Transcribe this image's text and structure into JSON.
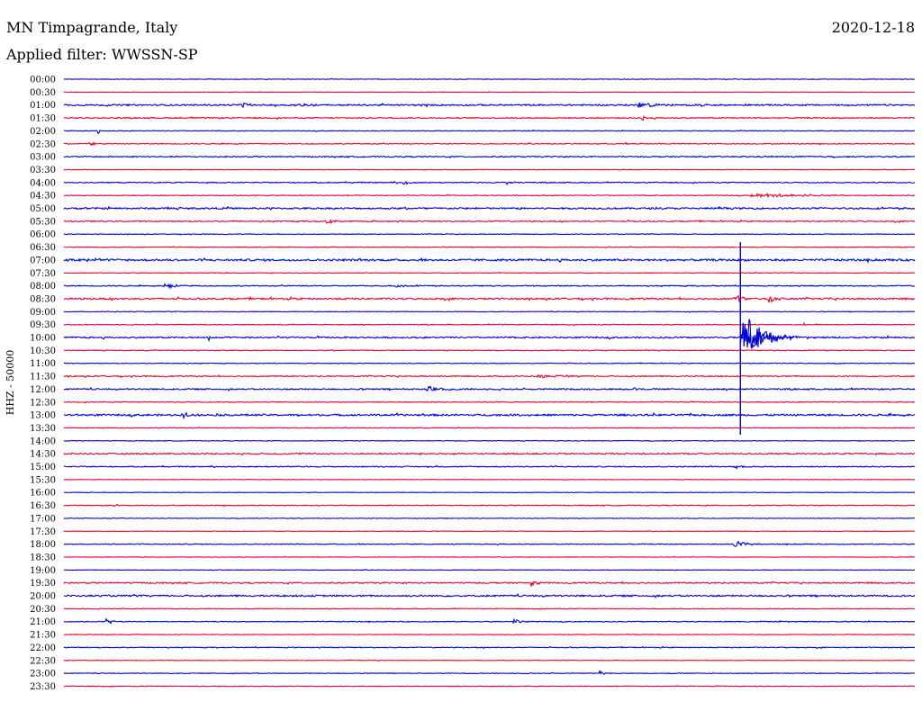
{
  "header": {
    "station": "MN Timpagrande, Italy",
    "date": "2020-12-18",
    "filter": "Applied filter: WWSSN-SP"
  },
  "chart_data": {
    "type": "line",
    "title": "MN Timpagrande, Italy",
    "subtitle": "Applied filter: WWSSN-SP",
    "ylabel": "HHZ - 50000",
    "colors": {
      "even_row": "#0000cc",
      "odd_row": "#e8002a"
    },
    "rows": [
      {
        "label": "00:00",
        "amp": 0.3,
        "events": []
      },
      {
        "label": "00:30",
        "amp": 0.2,
        "events": []
      },
      {
        "label": "01:00",
        "amp": 0.9,
        "events": [
          {
            "pos": 0.21,
            "width": 0.02,
            "amp": 3
          },
          {
            "pos": 0.27,
            "width": 0.04,
            "amp": 2
          },
          {
            "pos": 0.68,
            "width": 0.08,
            "amp": 1.6
          }
        ]
      },
      {
        "label": "01:30",
        "amp": 0.7,
        "events": [
          {
            "pos": 0.68,
            "width": 0.01,
            "amp": 2.5
          }
        ]
      },
      {
        "label": "02:00",
        "amp": 0.4,
        "events": [
          {
            "pos": 0.04,
            "width": 0.005,
            "amp": 3
          }
        ]
      },
      {
        "label": "02:30",
        "amp": 0.5,
        "events": [
          {
            "pos": 0.03,
            "width": 0.02,
            "amp": 2
          },
          {
            "pos": 0.66,
            "width": 0.004,
            "amp": 2
          }
        ]
      },
      {
        "label": "03:00",
        "amp": 0.7,
        "events": []
      },
      {
        "label": "03:30",
        "amp": 0.3,
        "events": []
      },
      {
        "label": "04:00",
        "amp": 0.6,
        "events": [
          {
            "pos": 0.4,
            "width": 0.02,
            "amp": 2
          },
          {
            "pos": 0.52,
            "width": 0.02,
            "amp": 2
          }
        ]
      },
      {
        "label": "04:30",
        "amp": 0.5,
        "events": [
          {
            "pos": 0.82,
            "width": 0.18,
            "amp": 1.5
          }
        ]
      },
      {
        "label": "05:00",
        "amp": 1.0,
        "events": []
      },
      {
        "label": "05:30",
        "amp": 0.7,
        "events": [
          {
            "pos": 0.31,
            "width": 0.02,
            "amp": 3
          },
          {
            "pos": 0.36,
            "width": 0.01,
            "amp": 2
          }
        ]
      },
      {
        "label": "06:00",
        "amp": 0.4,
        "events": []
      },
      {
        "label": "06:30",
        "amp": 0.4,
        "events": []
      },
      {
        "label": "07:00",
        "amp": 1.2,
        "events": [
          {
            "pos": 0.02,
            "width": 0.04,
            "amp": 1.6
          }
        ]
      },
      {
        "label": "07:30",
        "amp": 0.4,
        "events": []
      },
      {
        "label": "08:00",
        "amp": 0.6,
        "events": [
          {
            "pos": 0.12,
            "width": 0.04,
            "amp": 2.4
          },
          {
            "pos": 0.39,
            "width": 0.03,
            "amp": 1.8
          }
        ]
      },
      {
        "label": "08:30",
        "amp": 1.0,
        "events": [
          {
            "pos": 0.79,
            "width": 0.02,
            "amp": 4
          },
          {
            "pos": 0.83,
            "width": 0.03,
            "amp": 3
          }
        ]
      },
      {
        "label": "09:00",
        "amp": 0.4,
        "events": []
      },
      {
        "label": "09:30",
        "amp": 0.5,
        "events": [
          {
            "pos": 0.87,
            "width": 0.003,
            "amp": 2.5
          }
        ]
      },
      {
        "label": "10:00",
        "amp": 0.9,
        "events": [
          {
            "pos": 0.17,
            "width": 0.02,
            "amp": 3
          },
          {
            "pos": 0.805,
            "width": 0.06,
            "amp": 18
          }
        ]
      },
      {
        "label": "10:30",
        "amp": 0.5,
        "events": []
      },
      {
        "label": "11:00",
        "amp": 0.4,
        "events": []
      },
      {
        "label": "11:30",
        "amp": 0.7,
        "events": [
          {
            "pos": 0.56,
            "width": 0.05,
            "amp": 1.7
          }
        ]
      },
      {
        "label": "12:00",
        "amp": 0.8,
        "events": [
          {
            "pos": 0.43,
            "width": 0.05,
            "amp": 2.3
          },
          {
            "pos": 0.67,
            "width": 0.01,
            "amp": 2
          }
        ]
      },
      {
        "label": "12:30",
        "amp": 0.5,
        "events": []
      },
      {
        "label": "13:00",
        "amp": 1.1,
        "events": [
          {
            "pos": 0.14,
            "width": 0.02,
            "amp": 2.5
          }
        ]
      },
      {
        "label": "13:30",
        "amp": 0.4,
        "events": []
      },
      {
        "label": "14:00",
        "amp": 0.4,
        "events": []
      },
      {
        "label": "14:30",
        "amp": 0.8,
        "events": []
      },
      {
        "label": "15:00",
        "amp": 0.6,
        "events": [
          {
            "pos": 0.79,
            "width": 0.02,
            "amp": 1.8
          }
        ]
      },
      {
        "label": "15:30",
        "amp": 0.3,
        "events": []
      },
      {
        "label": "16:00",
        "amp": 0.3,
        "events": []
      },
      {
        "label": "16:30",
        "amp": 0.5,
        "events": [
          {
            "pos": 0.06,
            "width": 0.01,
            "amp": 2
          }
        ]
      },
      {
        "label": "17:00",
        "amp": 0.3,
        "events": []
      },
      {
        "label": "17:30",
        "amp": 0.3,
        "events": []
      },
      {
        "label": "18:00",
        "amp": 0.5,
        "events": [
          {
            "pos": 0.79,
            "width": 0.04,
            "amp": 3
          }
        ]
      },
      {
        "label": "18:30",
        "amp": 0.3,
        "events": []
      },
      {
        "label": "19:00",
        "amp": 0.3,
        "events": []
      },
      {
        "label": "19:30",
        "amp": 0.8,
        "events": [
          {
            "pos": 0.55,
            "width": 0.02,
            "amp": 2
          }
        ]
      },
      {
        "label": "20:00",
        "amp": 1.0,
        "events": []
      },
      {
        "label": "20:30",
        "amp": 0.4,
        "events": []
      },
      {
        "label": "21:00",
        "amp": 0.5,
        "events": [
          {
            "pos": 0.05,
            "width": 0.02,
            "amp": 3
          },
          {
            "pos": 0.53,
            "width": 0.03,
            "amp": 2.5
          }
        ]
      },
      {
        "label": "21:30",
        "amp": 0.3,
        "events": []
      },
      {
        "label": "22:00",
        "amp": 0.5,
        "events": []
      },
      {
        "label": "22:30",
        "amp": 0.3,
        "events": []
      },
      {
        "label": "23:00",
        "amp": 0.4,
        "events": [
          {
            "pos": 0.63,
            "width": 0.015,
            "amp": 2.5
          }
        ]
      },
      {
        "label": "23:30",
        "amp": 0.4,
        "events": []
      }
    ]
  }
}
